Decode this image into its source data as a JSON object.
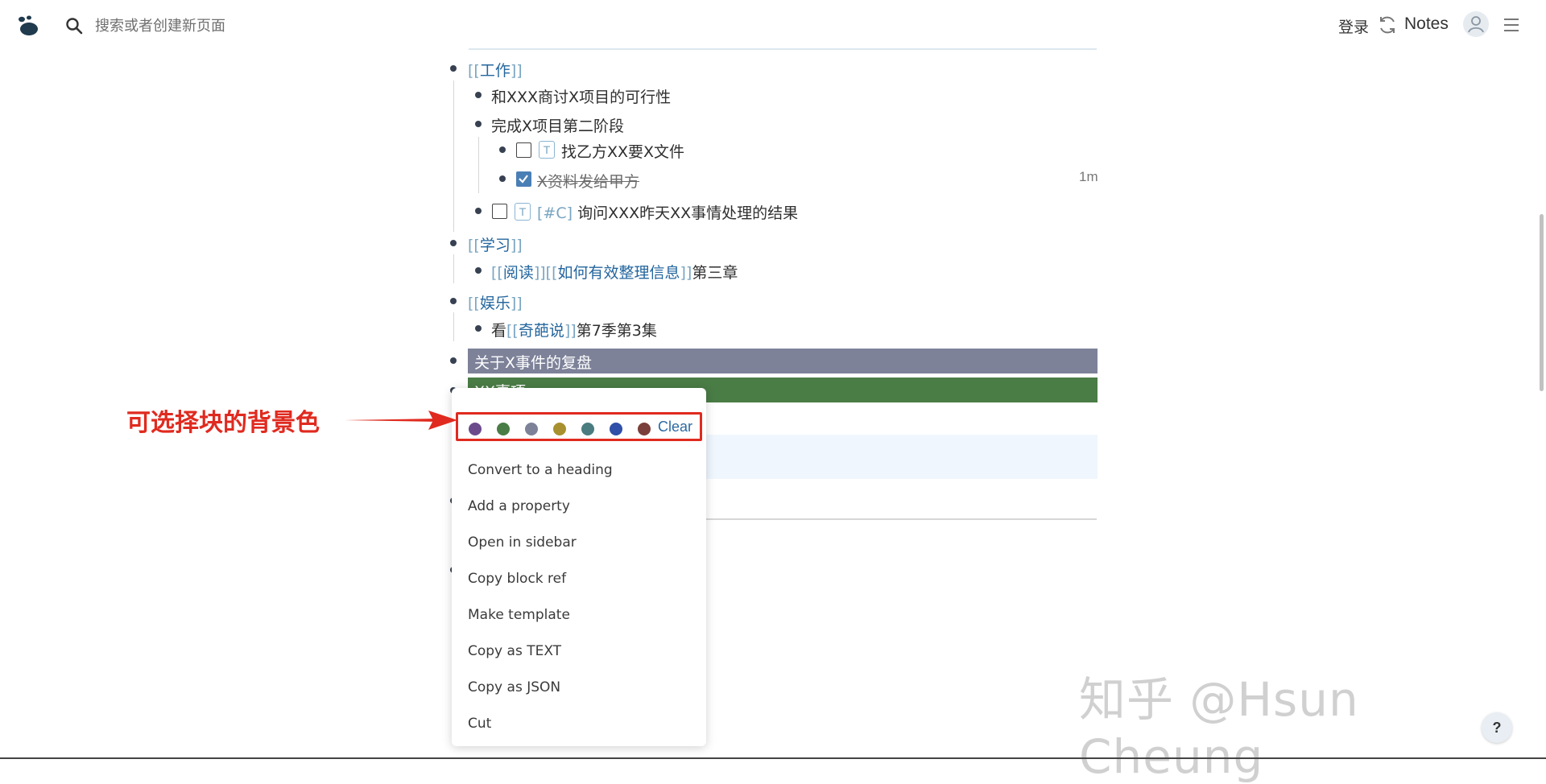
{
  "header": {
    "search_placeholder": "搜索或者创建新页面",
    "login_label": "登录",
    "notes_label": "Notes"
  },
  "outline": {
    "work_ref": "工作",
    "work_items": {
      "item1": "和XXX商讨X项目的可行性",
      "item2": "完成X项目第二阶段",
      "todo1": {
        "badge": "T",
        "text": "找乙方XX要X文件",
        "checked": false
      },
      "todo2": {
        "text": "X资料发给甲方",
        "checked": true,
        "time": "1m"
      },
      "todo3": {
        "badge": "T",
        "tag": "[#C]",
        "text": "询问XXX昨天XX事情处理的结果",
        "checked": false
      }
    },
    "study_ref": "学习",
    "study_item": {
      "ref1": "阅读",
      "ref2": "如何有效整理信息",
      "suffix": "第三章"
    },
    "fun_ref": "娱乐",
    "fun_item": {
      "prefix": "看",
      "ref": "奇葩说",
      "suffix": "第7季第3集"
    },
    "highlight_block1": "关于X事件的复盘",
    "highlight_block2": "XX事项",
    "highlight_colors": {
      "block1": "#7d8299",
      "block2": "#4a7c46"
    }
  },
  "context_menu": {
    "swatches": [
      {
        "name": "purple",
        "color": "#6b4a8c"
      },
      {
        "name": "green",
        "color": "#4a7c46"
      },
      {
        "name": "gray",
        "color": "#7d8299"
      },
      {
        "name": "yellow",
        "color": "#a8902e"
      },
      {
        "name": "teal",
        "color": "#4a7c80"
      },
      {
        "name": "blue",
        "color": "#2f4fa8"
      },
      {
        "name": "red",
        "color": "#7a3f3a"
      }
    ],
    "clear_label": "Clear",
    "items": [
      "Convert to a heading",
      "Add a property",
      "Open in sidebar",
      "Copy block ref",
      "Make template",
      "Copy as TEXT",
      "Copy as JSON",
      "Cut"
    ]
  },
  "annotation": {
    "label": "可选择块的背景色",
    "color": "#e02a1f"
  },
  "watermark": "知乎 @Hsun Cheung",
  "help_label": "?"
}
